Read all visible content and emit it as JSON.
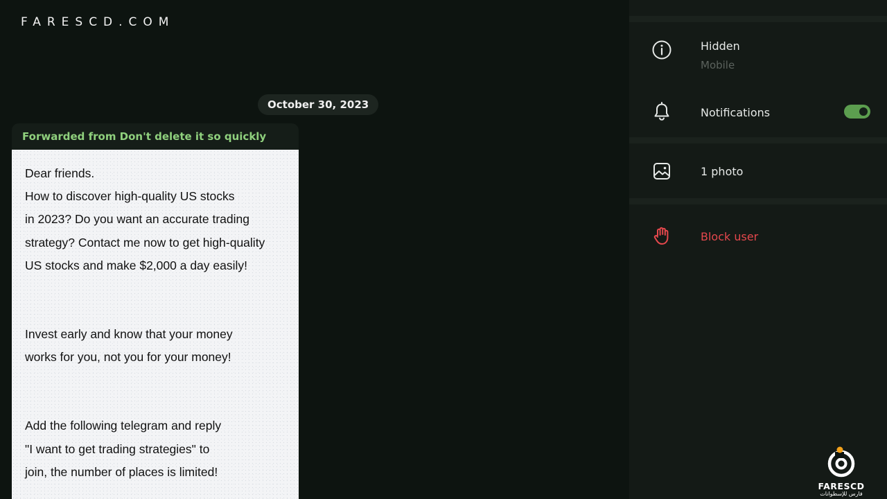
{
  "watermark": "FARESCD.COM",
  "chat": {
    "date": "October 30, 2023",
    "message": {
      "forwarded_from": "Forwarded from Don't delete it so quickly",
      "paragraphs": [
        [
          "Dear friends.",
          "How to discover high-quality US stocks",
          "in 2023? Do you want an accurate trading",
          "strategy? Contact me now to get high-quality",
          "US stocks and make $2,000 a day easily!"
        ],
        [
          "Invest early and know that your money",
          "works for you, not you for your money!"
        ],
        [
          "Add the following telegram and reply",
          "\"I want to get trading strategies\" to",
          "join, the number of places is limited!"
        ]
      ]
    }
  },
  "panel": {
    "phone": {
      "icon": "info-icon",
      "title": "Hidden",
      "subtitle": "Mobile"
    },
    "notifications": {
      "icon": "bell-icon",
      "label": "Notifications",
      "enabled": true
    },
    "media": {
      "icon": "image-icon",
      "label": "1 photo"
    },
    "block": {
      "icon": "hand-stop-icon",
      "label": "Block user"
    }
  },
  "logo": {
    "name": "FARESCD",
    "subtitle": "فارس للإسطوانات"
  },
  "colors": {
    "accent_green": "#5c9e4f",
    "forward_green": "#8fd07d",
    "danger_red": "#e5484d"
  }
}
